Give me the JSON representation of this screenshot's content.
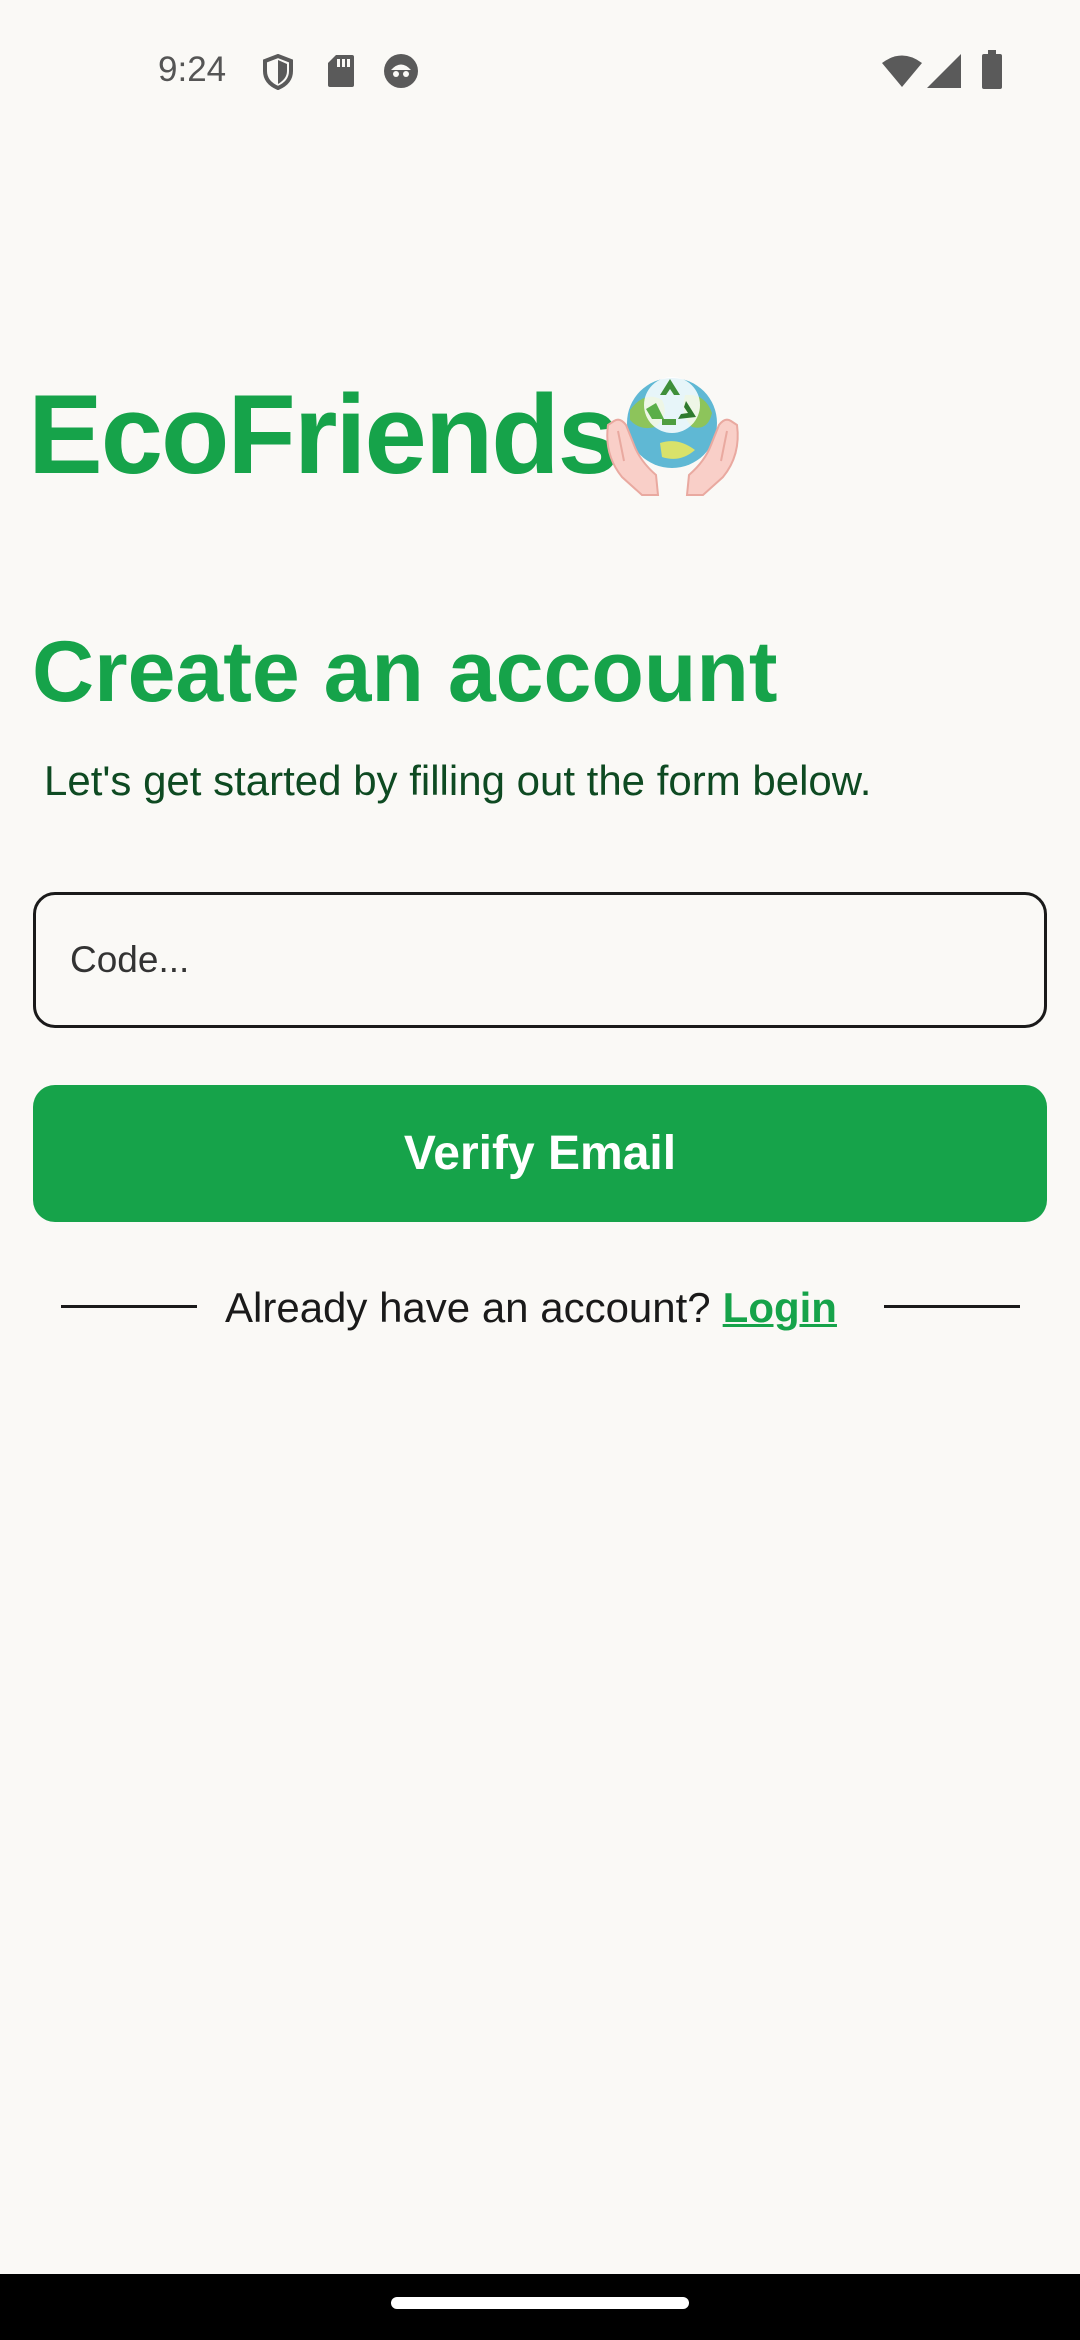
{
  "status_bar": {
    "time": "9:24",
    "left_icons": [
      "shield-icon",
      "sd-card-icon",
      "robot-face-icon"
    ],
    "right_icons": [
      "wifi-icon",
      "cell-signal-icon",
      "battery-icon"
    ]
  },
  "brand": {
    "name": "EcoFriends",
    "logo_icon": "hands-holding-earth-recycle-icon"
  },
  "page": {
    "heading": "Create an account",
    "subtitle": "Let's get started by filling out the form below."
  },
  "form": {
    "code_input": {
      "placeholder": "Code...",
      "value": ""
    },
    "verify_button_label": "Verify Email"
  },
  "login_prompt": {
    "text": "Already have an account?",
    "link_label": "Login"
  },
  "colors": {
    "accent": "#16A34A",
    "subtitle": "#0E4A22",
    "background": "#FAF9F6",
    "text": "#1A1A1A"
  }
}
